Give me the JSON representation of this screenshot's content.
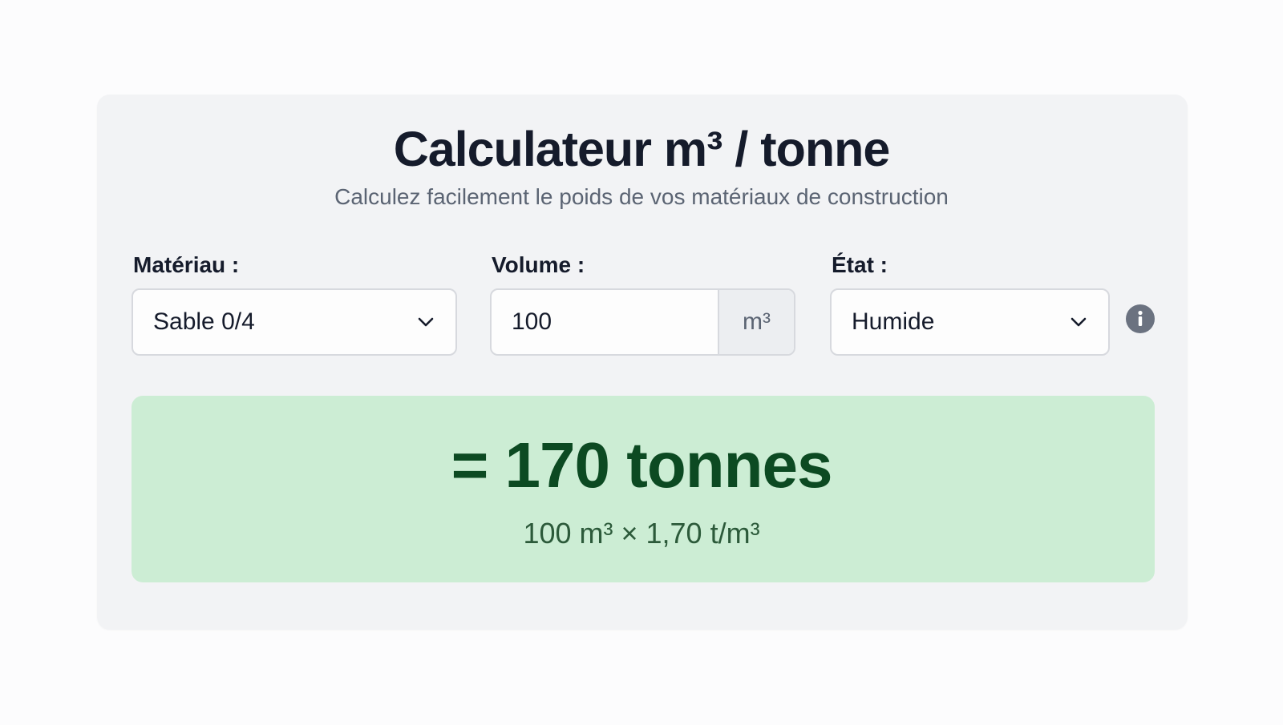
{
  "header": {
    "title": "Calculateur m³ / tonne",
    "subtitle": "Calculez facilement le poids de vos matériaux de construction"
  },
  "form": {
    "material": {
      "label": "Matériau :",
      "selected": "Sable 0/4",
      "icon": "chevron-down-icon"
    },
    "volume": {
      "label": "Volume :",
      "value": "100",
      "unit": "m³"
    },
    "state": {
      "label": "État :",
      "selected": "Humide",
      "icon": "chevron-down-icon",
      "info_icon": "info-icon"
    }
  },
  "result": {
    "value": "= 170 tonnes",
    "formula": "100 m³ × 1,70 t/m³"
  },
  "colors": {
    "card_background": "#f2f3f5",
    "result_background": "#ccedd4",
    "result_text": "#0c4a22",
    "title_text": "#151b2b",
    "muted_text": "#5b6473"
  }
}
